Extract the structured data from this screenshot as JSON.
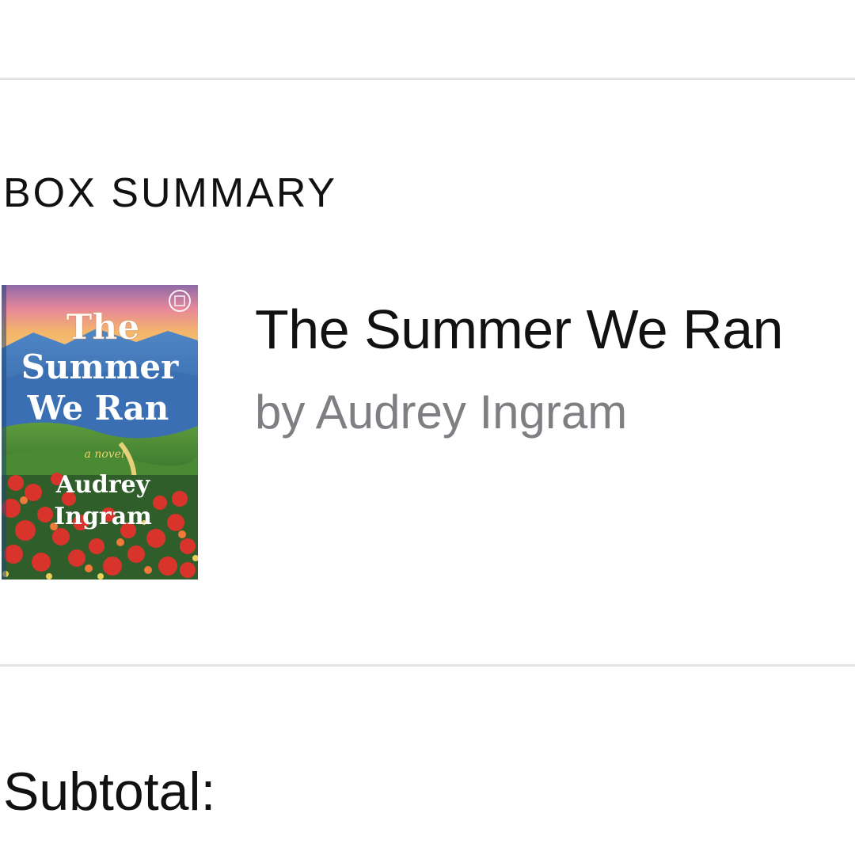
{
  "section": {
    "heading": "BOX SUMMARY"
  },
  "item": {
    "title": "The Summer We Ran",
    "author_line": "by Audrey Ingram",
    "cover": {
      "title_lines": [
        "The",
        "Summer",
        "We Ran"
      ],
      "subtitle": "a novel",
      "author_lines": [
        "Audrey",
        "Ingram"
      ],
      "badge_icon": "botm-badge-icon"
    }
  },
  "footer": {
    "subtotal_label": "Subtotal:"
  },
  "colors": {
    "divider": "#e3e4e6",
    "text_primary": "#111111",
    "text_secondary": "#7d7f82"
  }
}
